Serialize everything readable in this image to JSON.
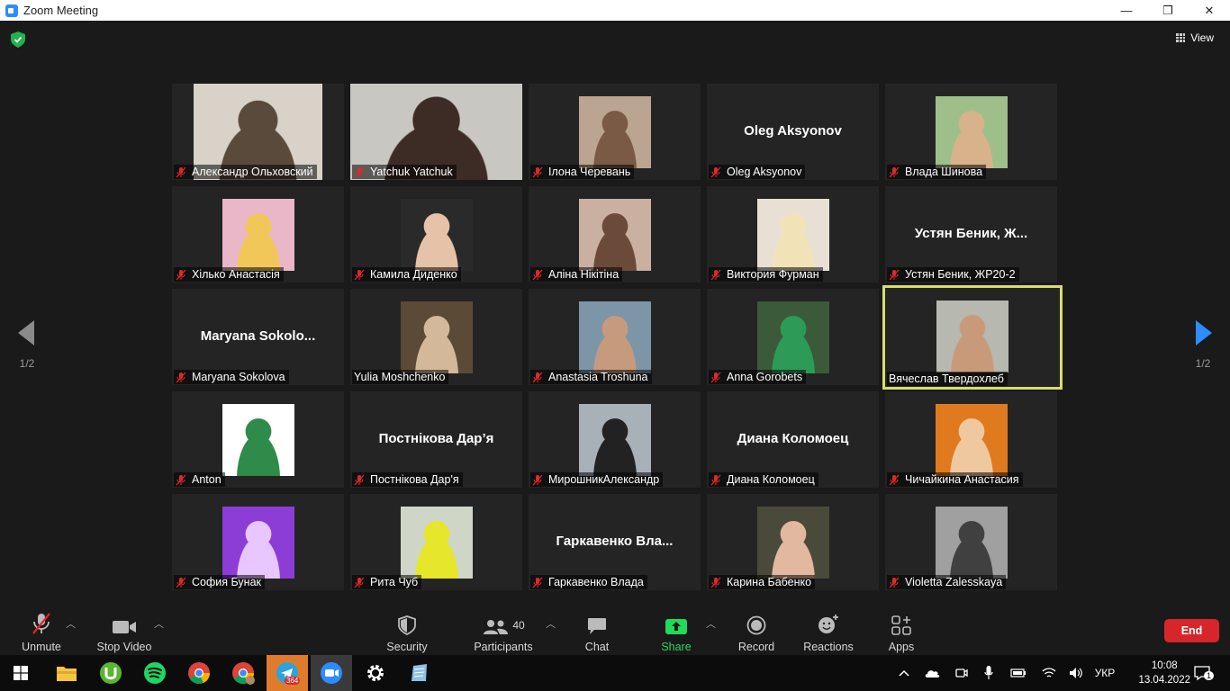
{
  "window": {
    "title": "Zoom Meeting",
    "minimize": "—",
    "maximize": "❐",
    "close": "✕"
  },
  "top_bar": {
    "view_label": "View"
  },
  "pagination": {
    "left": "1/2",
    "right": "1/2"
  },
  "tiles": [
    {
      "name": "Александр Ольховский",
      "muted": true
    },
    {
      "name": "Yatchuk Yatchuk",
      "muted": true
    },
    {
      "name": "Ілона Черевань",
      "muted": true
    },
    {
      "name": "Oleg Aksyonov",
      "muted": true,
      "display": "Oleg Aksyonov"
    },
    {
      "name": "Влада Шинова",
      "muted": true
    },
    {
      "name": "Хілько  Анастасія",
      "muted": true
    },
    {
      "name": "Камила Диденко",
      "muted": true
    },
    {
      "name": "Аліна Нікітіна",
      "muted": true
    },
    {
      "name": "Виктория Фурман",
      "muted": true
    },
    {
      "name": "Устян Беник, ЖР20-2",
      "muted": true,
      "display": "Устян  Беник,  Ж..."
    },
    {
      "name": "Maryana Sokolova",
      "muted": true,
      "display": "Maryana  Sokolo..."
    },
    {
      "name": "Yulia Moshchenko",
      "muted": false
    },
    {
      "name": "Anastasia Troshuna",
      "muted": true
    },
    {
      "name": "Anna Gorobets",
      "muted": true
    },
    {
      "name": "Вячеслав Твердохлеб",
      "muted": false,
      "active": true
    },
    {
      "name": "Anton",
      "muted": true
    },
    {
      "name": "Постнікова Дар'я",
      "muted": true,
      "display": "Постнікова Дар’я"
    },
    {
      "name": "МирошникАлександр",
      "muted": true
    },
    {
      "name": "Диана Коломоец",
      "muted": true,
      "display": "Диана Коломоец"
    },
    {
      "name": "Чичайкина Анастасия",
      "muted": true
    },
    {
      "name": "София Бунак",
      "muted": true
    },
    {
      "name": "Рита Чуб",
      "muted": true
    },
    {
      "name": "Гаркавенко Влада",
      "muted": true,
      "display": "Гаркавенко  Вла..."
    },
    {
      "name": "Карина Бабенко",
      "muted": true
    },
    {
      "name": "Violetta Zalesskaya",
      "muted": true
    }
  ],
  "toolbar": {
    "unmute": "Unmute",
    "stop_video": "Stop Video",
    "security": "Security",
    "participants": "Participants",
    "participants_count": "40",
    "chat": "Chat",
    "share_screen": "Share Screen",
    "record": "Record",
    "reactions": "Reactions",
    "apps": "Apps",
    "end": "End"
  },
  "taskbar": {
    "telegram_badge": "364",
    "language": "УКР",
    "time": "10:08",
    "date": "13.04.2022",
    "notifications": "1"
  },
  "colors": {
    "accent": "#2D8CFF",
    "active_speaker": "#d7de6b",
    "end": "#d7262b",
    "share": "#23d959",
    "mute": "#e02828"
  }
}
